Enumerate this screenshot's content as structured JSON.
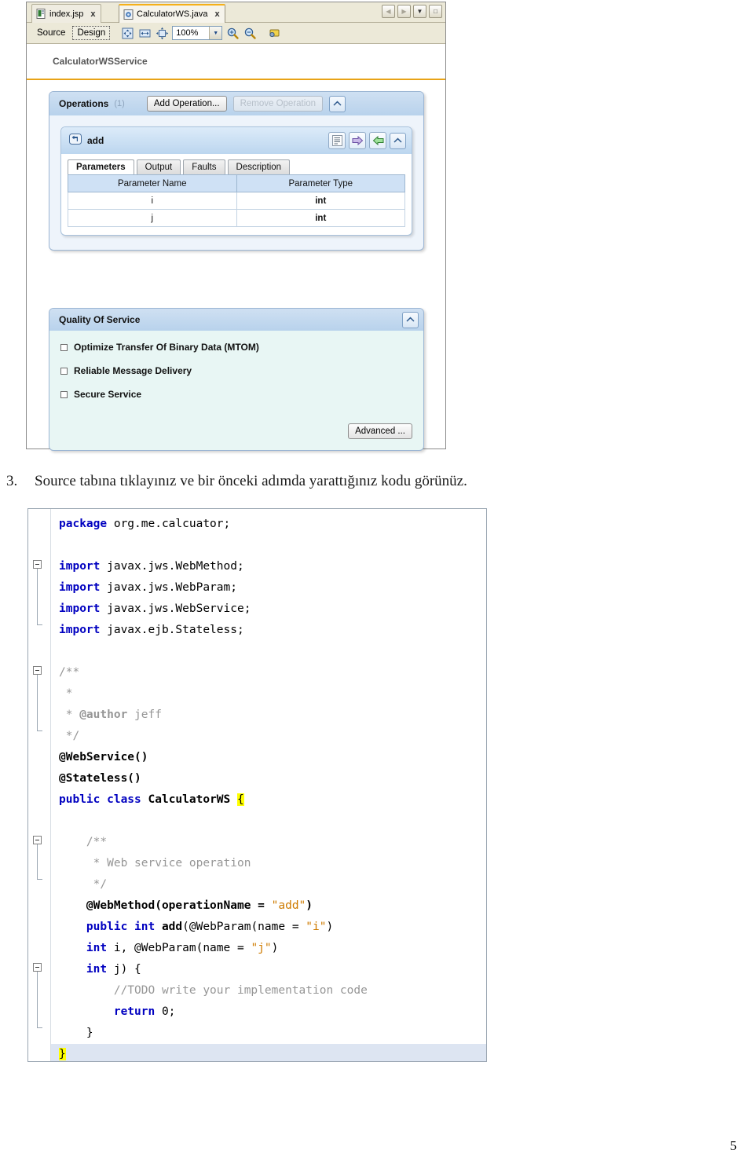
{
  "ide": {
    "tabs": [
      {
        "label": "index.jsp",
        "icon": "jsp-file-icon",
        "active": false,
        "close": "x"
      },
      {
        "label": "CalculatorWS.java",
        "icon": "java-file-icon",
        "active": true,
        "close": "x"
      }
    ],
    "window_buttons": [
      {
        "name": "scroll-left-button",
        "glyph": "◀"
      },
      {
        "name": "scroll-right-button",
        "glyph": "▶"
      },
      {
        "name": "tab-list-button",
        "glyph": "▼"
      },
      {
        "name": "maximize-button",
        "glyph": "□"
      }
    ],
    "toolbar": {
      "source_tab": "Source",
      "design_tab": "Design",
      "zoom_value": "100%",
      "icons": [
        "fit-to-window-icon",
        "fit-width-icon",
        "actual-size-icon",
        "zoom-in-icon",
        "zoom-out-icon",
        "preferences-icon"
      ]
    },
    "service_name": "CalculatorWSService",
    "operations": {
      "title": "Operations",
      "count": "(1)",
      "add_button": "Add Operation...",
      "remove_button": "Remove Operation",
      "collapse_glyph": "▲",
      "operation": {
        "name": "add",
        "icons": [
          "description-icon",
          "add-parameter-icon",
          "add-fault-icon"
        ],
        "collapse_glyph": "▲",
        "tabs": [
          "Parameters",
          "Output",
          "Faults",
          "Description"
        ],
        "active_tab": "Parameters",
        "table": {
          "headers": [
            "Parameter Name",
            "Parameter Type"
          ],
          "rows": [
            [
              "i",
              "int"
            ],
            [
              "j",
              "int"
            ]
          ]
        }
      }
    },
    "quality_of_service": {
      "title": "Quality Of Service",
      "collapse_glyph": "▲",
      "checkboxes": [
        {
          "label": "Optimize Transfer Of Binary Data (MTOM)",
          "checked": false
        },
        {
          "label": "Reliable Message Delivery",
          "checked": false
        },
        {
          "label": "Secure Service",
          "checked": false
        }
      ],
      "advanced_button": "Advanced ..."
    }
  },
  "document": {
    "step_number": "3.",
    "step_text": "Source tabına tıklayınız ve bir önceki adımda yarattığınız kodu görünüz.",
    "page_number": "5"
  },
  "code": {
    "lines": [
      {
        "id": "l1",
        "segments": [
          {
            "t": "package ",
            "c": "kw"
          },
          {
            "t": "org.me.calcuator;",
            "c": ""
          }
        ]
      },
      {
        "id": "l2",
        "segments": []
      },
      {
        "id": "l3",
        "segments": [
          {
            "t": "import ",
            "c": "kw"
          },
          {
            "t": "javax.jws.WebMethod;",
            "c": ""
          }
        ]
      },
      {
        "id": "l4",
        "segments": [
          {
            "t": "import ",
            "c": "kw"
          },
          {
            "t": "javax.jws.WebParam;",
            "c": ""
          }
        ]
      },
      {
        "id": "l5",
        "segments": [
          {
            "t": "import ",
            "c": "kw"
          },
          {
            "t": "javax.jws.WebService;",
            "c": ""
          }
        ]
      },
      {
        "id": "l6",
        "segments": [
          {
            "t": "import ",
            "c": "kw"
          },
          {
            "t": "javax.ejb.Stateless;",
            "c": ""
          }
        ]
      },
      {
        "id": "l7",
        "segments": []
      },
      {
        "id": "l8",
        "segments": [
          {
            "t": "/**",
            "c": "cmt"
          }
        ]
      },
      {
        "id": "l9",
        "segments": [
          {
            "t": " *",
            "c": "cmt"
          }
        ]
      },
      {
        "id": "l10",
        "segments": [
          {
            "t": " * ",
            "c": "cmt"
          },
          {
            "t": "@author",
            "c": "cmtb"
          },
          {
            "t": " jeff",
            "c": "cmt"
          }
        ]
      },
      {
        "id": "l11",
        "segments": [
          {
            "t": " */",
            "c": "cmt"
          }
        ]
      },
      {
        "id": "l12",
        "segments": [
          {
            "t": "@WebService()",
            "c": "bold"
          }
        ]
      },
      {
        "id": "l13",
        "segments": [
          {
            "t": "@Stateless()",
            "c": "bold"
          }
        ]
      },
      {
        "id": "l14",
        "segments": [
          {
            "t": "public class ",
            "c": "kw"
          },
          {
            "t": "CalculatorWS ",
            "c": "bold"
          },
          {
            "t": "{",
            "c": "brace-hl"
          }
        ]
      },
      {
        "id": "l15",
        "segments": []
      },
      {
        "id": "l16",
        "segments": [
          {
            "t": "    /**",
            "c": "cmt"
          }
        ]
      },
      {
        "id": "l17",
        "segments": [
          {
            "t": "     * Web service operation",
            "c": "cmt"
          }
        ]
      },
      {
        "id": "l18",
        "segments": [
          {
            "t": "     */",
            "c": "cmt"
          }
        ]
      },
      {
        "id": "l19",
        "segments": [
          {
            "t": "    @WebMethod(operationName = ",
            "c": "bold"
          },
          {
            "t": "\"add\"",
            "c": "str"
          },
          {
            "t": ")",
            "c": "bold"
          }
        ]
      },
      {
        "id": "l20",
        "segments": [
          {
            "t": "    public int ",
            "c": "kw"
          },
          {
            "t": "add",
            "c": "bold"
          },
          {
            "t": "(@WebParam(name = ",
            "c": ""
          },
          {
            "t": "\"i\"",
            "c": "str"
          },
          {
            "t": ")",
            "c": ""
          }
        ]
      },
      {
        "id": "l21",
        "segments": [
          {
            "t": "    int ",
            "c": "kw"
          },
          {
            "t": "i, @WebParam(name = ",
            "c": ""
          },
          {
            "t": "\"j\"",
            "c": "str"
          },
          {
            "t": ")",
            "c": ""
          }
        ]
      },
      {
        "id": "l22",
        "segments": [
          {
            "t": "    int ",
            "c": "kw"
          },
          {
            "t": "j) {",
            "c": ""
          }
        ]
      },
      {
        "id": "l23",
        "segments": [
          {
            "t": "        //TODO write your implementation code",
            "c": "cmt"
          }
        ]
      },
      {
        "id": "l24",
        "segments": [
          {
            "t": "        return ",
            "c": "kw"
          },
          {
            "t": "0;",
            "c": ""
          }
        ]
      },
      {
        "id": "l25",
        "segments": [
          {
            "t": "    }",
            "c": ""
          }
        ]
      },
      {
        "id": "l26",
        "segments": [
          {
            "t": "}",
            "c": "brace-hl"
          }
        ],
        "highlight": true
      }
    ]
  },
  "colors": {
    "accent_orange": "#e8a317",
    "panel_blue": "#b8d2ec",
    "qos_bg": "#e8f6f4",
    "keyword_blue": "#0000c0",
    "string_orange": "#ce7b00",
    "comment_grey": "#969696",
    "highlight_yellow": "#ffff00"
  }
}
